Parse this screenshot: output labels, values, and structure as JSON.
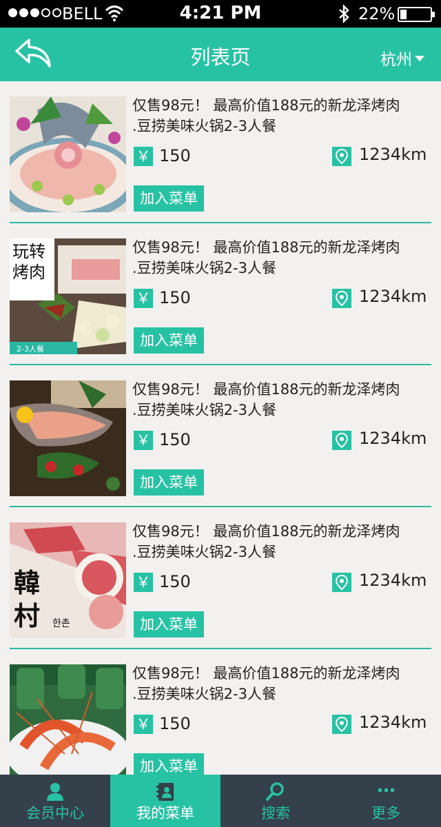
{
  "status_bar": {
    "carrier": "BELL",
    "time": "4:21 PM",
    "battery": "22%",
    "battery_level": 0.22,
    "signal_strength": 3
  },
  "nav": {
    "back_icon": "back-arrow-icon",
    "title": "列表页",
    "city": "杭州"
  },
  "list": [
    {
      "description": "仅售98元！ 最高价值188元的新龙泽烤肉\n.豆捞美味火锅2-3人餐",
      "currency": "￥",
      "price": "150",
      "distance": "1234km",
      "button": "加入菜单",
      "image": "fish-sashimi-platter"
    },
    {
      "description": "仅售98元！ 最高价值188元的新龙泽烤肉\n.豆捞美味火锅2-3人餐",
      "currency": "￥",
      "price": "150",
      "distance": "1234km",
      "button": "加入菜单",
      "image": "bbq-meat-set",
      "image_text": "玩转\n烤肉",
      "image_badge": "2-3人餐"
    },
    {
      "description": "仅售98元！ 最高价值188元的新龙泽烤肉\n.豆捞美味火锅2-3人餐",
      "currency": "￥",
      "price": "150",
      "distance": "1234km",
      "button": "加入菜单",
      "image": "fish-head-platter"
    },
    {
      "description": "仅售98元！ 最高价值188元的新龙泽烤肉\n.豆捞美味火锅2-3人餐",
      "currency": "￥",
      "price": "150",
      "distance": "1234km",
      "button": "加入菜单",
      "image": "korean-bbq-beef",
      "image_text": "韓\n村",
      "image_text_small": "한촌"
    },
    {
      "description": "仅售98元！ 最高价值188元的新龙泽烤肉\n.豆捞美味火锅2-3人餐",
      "currency": "￥",
      "price": "150",
      "distance": "1234km",
      "button": "加入菜单",
      "image": "shrimp-and-beer"
    }
  ],
  "tabs": [
    {
      "label": "会员中心",
      "icon": "user-icon",
      "active": false
    },
    {
      "label": "我的菜单",
      "icon": "contacts-book-icon",
      "active": true
    },
    {
      "label": "搜索",
      "icon": "search-icon",
      "active": false
    },
    {
      "label": "更多",
      "icon": "more-dots-icon",
      "active": false
    }
  ],
  "colors": {
    "accent": "#27c2a4",
    "tab_bar": "#34404a",
    "background": "#f3f1ef"
  }
}
